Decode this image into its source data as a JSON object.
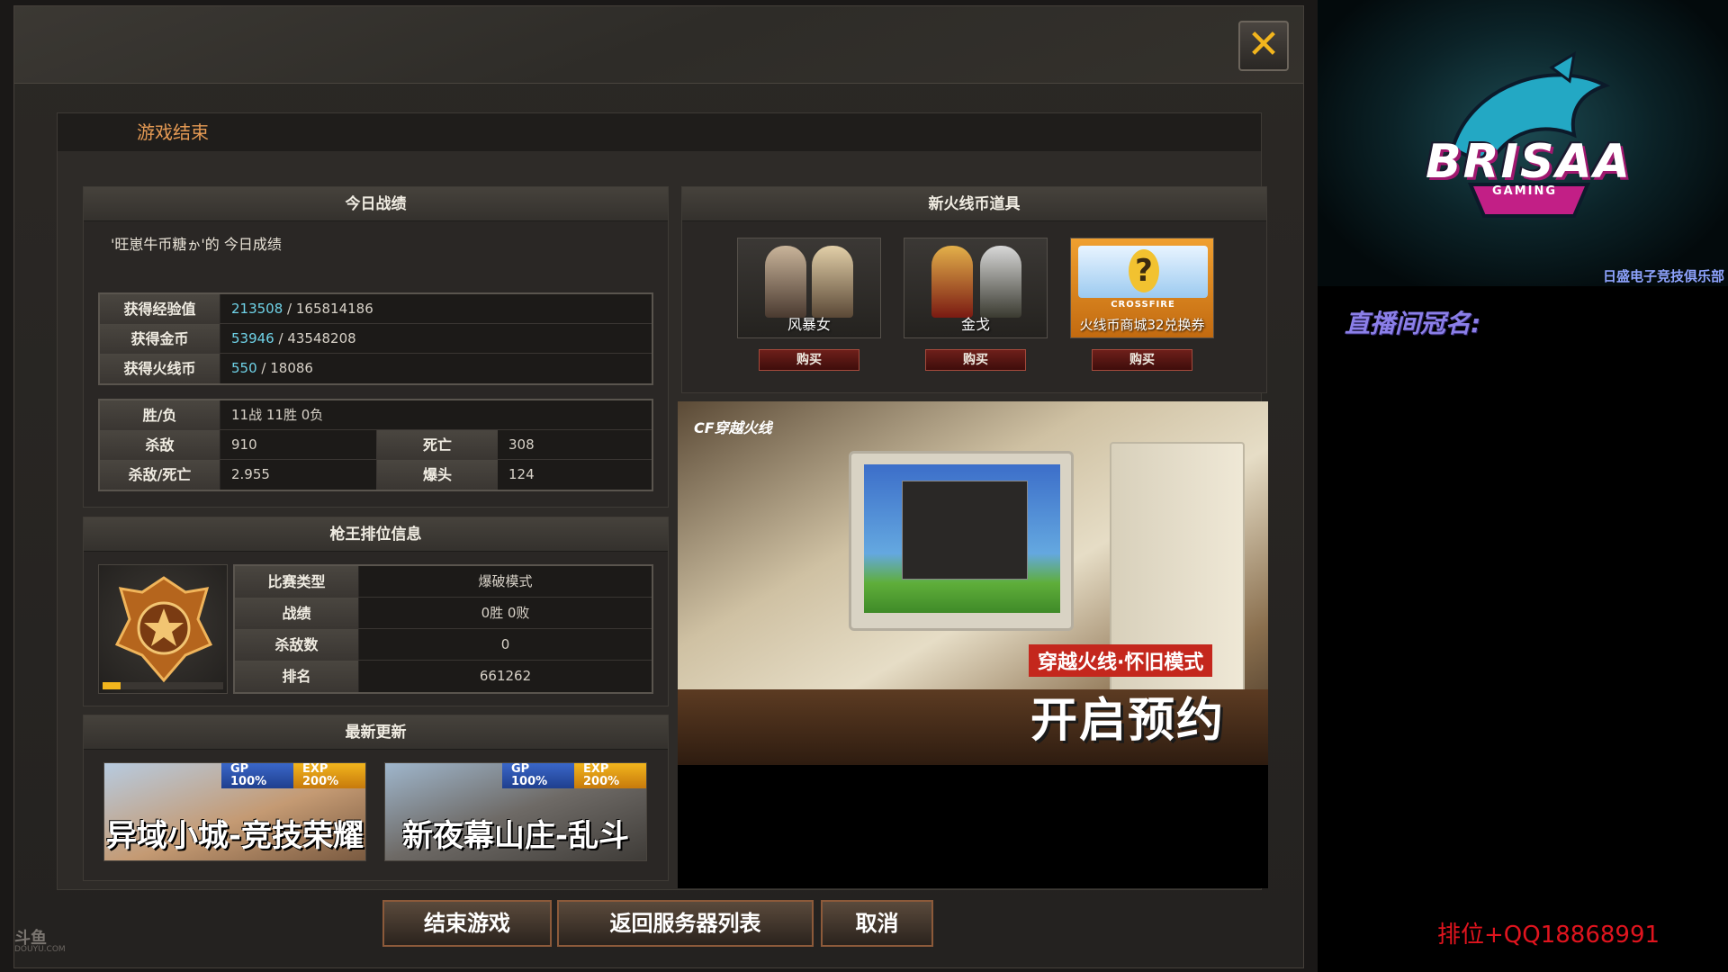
{
  "page_title": "游戏结束",
  "today": {
    "header": "今日战绩",
    "player_caption": "'旺崽牛币糖ゕ'的 今日成绩",
    "exp_label": "获得经验值",
    "exp_gain": "213508",
    "exp_sep": " / ",
    "exp_total": "165814186",
    "gold_label": "获得金币",
    "gold_gain": "53946",
    "gold_sep": " / ",
    "gold_total": "43548208",
    "cf_label": "获得火线币",
    "cf_gain": "550",
    "cf_sep": " / ",
    "cf_total": "18086",
    "winloss_label": "胜/负",
    "winloss_value": "11战 11胜 0负",
    "kills_label": "杀敌",
    "kills_value": "910",
    "deaths_label": "死亡",
    "deaths_value": "308",
    "kd_label": "杀敌/死亡",
    "kd_value": "2.955",
    "headshot_label": "爆头",
    "headshot_value": "124"
  },
  "rank": {
    "header": "枪王排位信息",
    "progress": 0.15,
    "rows": [
      {
        "label": "比赛类型",
        "value": "爆破模式"
      },
      {
        "label": "战绩",
        "value": "0胜 0败"
      },
      {
        "label": "杀敌数",
        "value": "0"
      },
      {
        "label": "排名",
        "value": "661262"
      }
    ]
  },
  "updates": {
    "header": "最新更新",
    "items": [
      {
        "title": "异域小城-竞技荣耀",
        "gp": "GP",
        "gp_rate": "100%",
        "exp": "EXP",
        "exp_rate": "200%"
      },
      {
        "title": "新夜幕山庄-乱斗",
        "gp": "GP",
        "gp_rate": "100%",
        "exp": "EXP",
        "exp_rate": "200%"
      }
    ]
  },
  "shop": {
    "header": "新火线币道具",
    "items": [
      {
        "name": "风暴女",
        "buy": "购买"
      },
      {
        "name": "金戈",
        "buy": "购买"
      },
      {
        "name": "火线币商城32兑换券",
        "buy": "购买",
        "brand": "CROSSFIRE"
      }
    ]
  },
  "promo": {
    "brand": "CF穿越火线",
    "subtitle": "穿越火线·怀旧模式",
    "headline": "开启预约"
  },
  "buttons": {
    "end_game": "结束游戏",
    "server_list": "返回服务器列表",
    "cancel": "取消"
  },
  "watermark": {
    "name": "斗鱼",
    "url": "DOUYU.COM"
  },
  "stream": {
    "team_name": "BRISAA",
    "team_sub": "GAMING",
    "club_name": "日盛电子竞技俱乐部",
    "naming_title": "直播间冠名:",
    "contact": "排位+QQ18868991"
  },
  "colors": {
    "highlight_value": "#6fd3e8",
    "title_orange": "#e59a54",
    "close_x": "#f2b51d",
    "contact_red": "#e0141e",
    "naming_purple": "#8b7fe8"
  }
}
